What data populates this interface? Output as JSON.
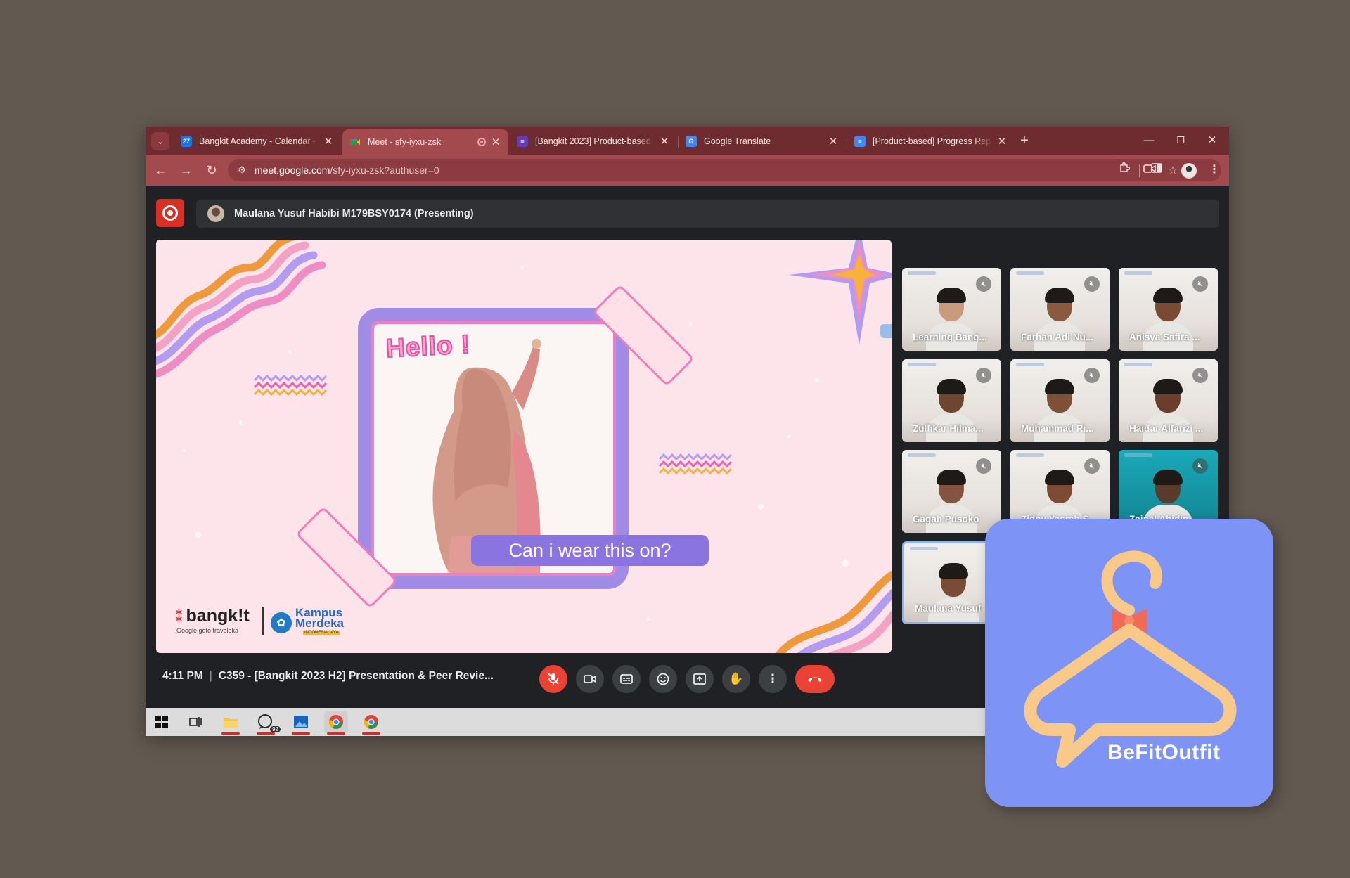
{
  "browser": {
    "tabs": [
      {
        "label": "Bangkit Academy - Calendar - I",
        "favicon": "calendar-icon",
        "color": "#1a73e8",
        "glyph": "27"
      },
      {
        "label": "Meet - sfy-iyxu-zsk",
        "favicon": "meet-icon",
        "color": "#00897b",
        "glyph": "",
        "active": true,
        "recording": true
      },
      {
        "label": "[Bangkit 2023] Product-based C",
        "favicon": "forms-icon",
        "color": "#673ab7",
        "glyph": "≡"
      },
      {
        "label": "Google Translate",
        "favicon": "translate-icon",
        "color": "#4285f4",
        "glyph": "G"
      },
      {
        "label": "[Product-based] Progress Repo",
        "favicon": "docs-icon",
        "color": "#4285f4",
        "glyph": "≡"
      }
    ],
    "close_glyph": "✕",
    "new_tab_glyph": "+",
    "url_domain": "meet.google.com",
    "url_path": "/sfy-iyxu-zsk?authuser=0"
  },
  "meet": {
    "presenter": "Maulana Yusuf Habibi M179BSY0174 (Presenting)",
    "slide": {
      "hello_text": "Hello !",
      "caption": "Can i wear this on?",
      "brand_bangkit": "bangk!t",
      "brand_partners": "Google   goto   traveloka",
      "kampus_line1": "Kampus",
      "kampus_line2": "Merdeka",
      "kampus_sub": "INDONESIA JAYA"
    },
    "participants": [
      {
        "name": "Learning Bang..."
      },
      {
        "name": "Farhan Adi Nu..."
      },
      {
        "name": "Anisya Safira ..."
      },
      {
        "name": "Zulfikar Hilma..."
      },
      {
        "name": "Muhammad Ri..."
      },
      {
        "name": "Haidar Alfarizi ..."
      },
      {
        "name": "Gagah Pusoko"
      },
      {
        "name": "Zidny Yasrah S..."
      },
      {
        "name": "Zainal Abidin"
      },
      {
        "name": "Maulana Yusuf"
      }
    ],
    "time": "4:11 PM",
    "time_separator": "|",
    "meeting_title": "C359 - [Bangkit 2023 H2] Presentation & Peer Revie...",
    "controls": [
      {
        "name": "mic-off-button",
        "glyph": "🎙",
        "style": "red"
      },
      {
        "name": "camera-button",
        "glyph": "▭",
        "style": "grey"
      },
      {
        "name": "captions-button",
        "glyph": "CC",
        "style": "grey"
      },
      {
        "name": "reactions-button",
        "glyph": "☺",
        "style": "grey"
      },
      {
        "name": "present-button",
        "glyph": "⇧",
        "style": "grey"
      },
      {
        "name": "raise-hand-button",
        "glyph": "✋",
        "style": "grey"
      },
      {
        "name": "more-options-button",
        "glyph": "⋮",
        "style": "grey"
      }
    ],
    "hangup_glyph": "☎"
  },
  "taskbar": {
    "whatsapp_badge": "92"
  },
  "logo": {
    "name": "BeFitOutfit"
  },
  "colors": {
    "page_bg": "#625950",
    "tab_strip": "#6e2c30",
    "toolbar": "#a34a4e",
    "meet_bg": "#202124",
    "hangup": "#ea4335",
    "slide_bg": "#fde3ea",
    "logo_bg": "#7d94f6",
    "logo_hanger": "#f9c98a"
  }
}
